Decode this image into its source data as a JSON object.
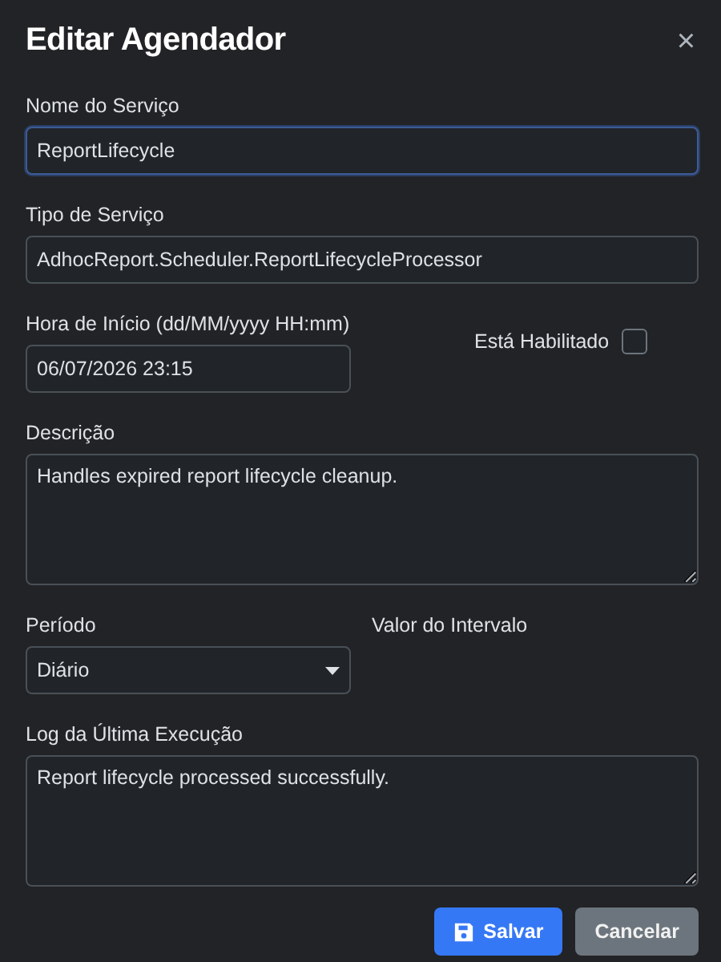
{
  "dialog": {
    "title": "Editar Agendador",
    "close": "×"
  },
  "rows": [
    [
      {
        "kind": "text",
        "label": "Nome do Serviço",
        "value": "ReportLifecycle",
        "focused": true
      }
    ],
    [
      {
        "kind": "text",
        "label": "Tipo de Serviço",
        "value": "AdhocReport.Scheduler.ReportLifecycleProcessor",
        "focused": false
      }
    ],
    [
      {
        "kind": "text",
        "label": "Hora de Início (dd/MM/yyyy HH:mm)",
        "value": "06/07/2026 23:15",
        "focused": false
      },
      {
        "kind": "checkbox",
        "label": "Está Habilitado",
        "checked": false
      }
    ],
    [
      {
        "kind": "textarea",
        "label": "Descrição",
        "value": "Handles expired report lifecycle cleanup.",
        "focused": false
      }
    ],
    [
      {
        "kind": "select",
        "label": "Período",
        "value": "Diário",
        "focused": false
      },
      {
        "kind": "label",
        "label": "Valor do Intervalo"
      }
    ],
    [
      {
        "kind": "textarea",
        "label": "Log da Última Execução",
        "value": "Report lifecycle processed successfully.",
        "focused": false
      }
    ]
  ],
  "buttons": [
    {
      "label": "Salvar",
      "kind": "primary"
    },
    {
      "label": "Cancelar",
      "kind": "secondary"
    }
  ]
}
